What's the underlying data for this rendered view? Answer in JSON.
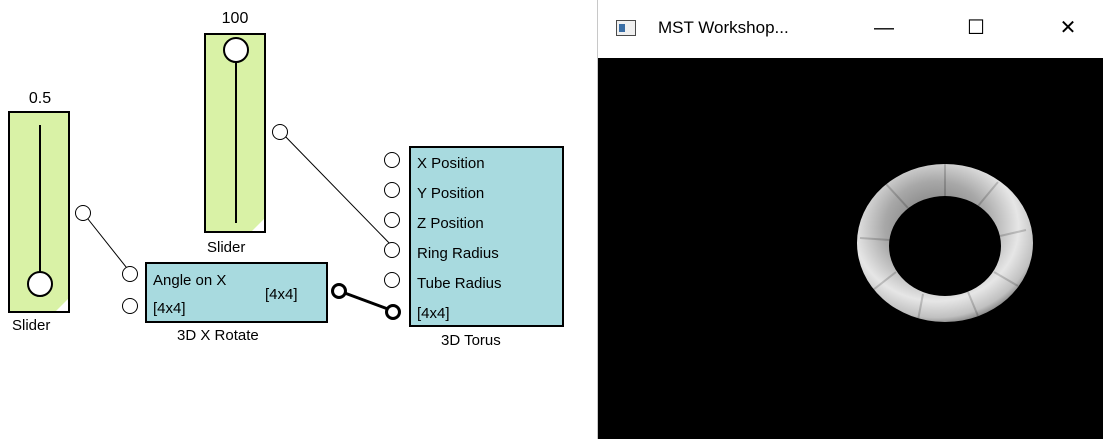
{
  "slider1": {
    "value": "0.5",
    "label": "Slider"
  },
  "slider2": {
    "value": "100",
    "label": "Slider"
  },
  "rotate": {
    "port1": "Angle on X",
    "port2": "[4x4]",
    "output": "[4x4]",
    "caption": "3D X Rotate"
  },
  "torus": {
    "ports": [
      "X Position",
      "Y Position",
      "Z Position",
      "Ring Radius",
      "Tube Radius",
      "[4x4]"
    ],
    "caption": "3D Torus"
  },
  "window": {
    "title": "MST Workshop...",
    "minimize": "—",
    "maximize": "☐",
    "close": "✕"
  },
  "colors": {
    "slider": "#d9f2a6",
    "block": "#a8dadf",
    "canvas": "#000000"
  }
}
